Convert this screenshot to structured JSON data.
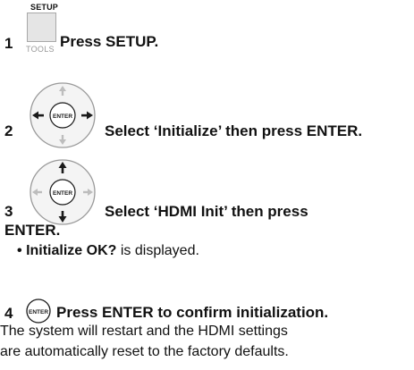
{
  "step1": {
    "number": "1",
    "button_top_label": "SETUP",
    "button_bottom_label": "TOOLS",
    "text": "Press SETUP."
  },
  "step2": {
    "number": "2",
    "dial_center_label": "ENTER",
    "text": "Select ‘Initialize’ then press ENTER."
  },
  "step3": {
    "number": "3",
    "dial_center_label": "ENTER",
    "text_line1": "Select ‘HDMI Init’ then press",
    "text_line2": "ENTER.",
    "bullet_bold": "Initialize OK?",
    "bullet_rest": "is displayed."
  },
  "step4": {
    "number": "4",
    "button_label": "ENTER",
    "text": "Press ENTER to confirm initialization.",
    "description_line1": "The system will restart and the HDMI settings",
    "description_line2": "are automatically reset to the factory defaults."
  },
  "icons": {
    "arrow_color": "#1a1a1a",
    "dial_ring_color": "#9a9a9a",
    "highlight_arrow_color": "#bdbdbd"
  }
}
